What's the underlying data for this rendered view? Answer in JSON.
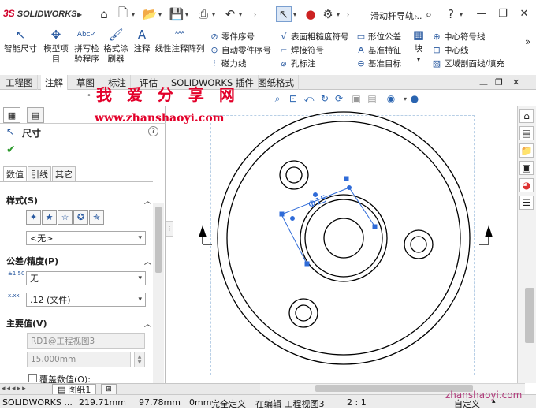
{
  "app": {
    "brand": "SOLIDWORKS",
    "brand_prefix": "3S",
    "doc_title": "滑动杆导轨...",
    "toolbar_icons": [
      "home-icon",
      "new-file-icon",
      "open-folder-icon",
      "save-icon",
      "print-icon",
      "undo-icon",
      "select-arrow-icon",
      "traffic-light-icon",
      "options-gear-icon"
    ]
  },
  "ribbon": {
    "smart_dim": "智能尺寸",
    "model_items_1": "模型项",
    "model_items_2": "目",
    "spell_1": "拼写检",
    "spell_2": "验程序",
    "format_1": "格式涂",
    "format_2": "刷器",
    "note": "注释",
    "linear_note": "线性注释阵列",
    "balloon": "零件序号",
    "auto_balloon": "自动零件序号",
    "magnetic_line": "磁力线",
    "surface_finish": "表面粗糙度符号",
    "weld_symbol": "焊接符号",
    "hole_callout": "孔标注",
    "geom_tol": "形位公差",
    "datum_feature": "基准特征",
    "datum_target": "基准目标",
    "block": "块",
    "center_mark": "中心符号线",
    "centerline": "中心线",
    "area_hatch": "区域剖面线/填充"
  },
  "tabs": [
    "工程图",
    "注解",
    "草图",
    "标注",
    "评估",
    "SOLIDWORKS 插件",
    "图纸格式"
  ],
  "active_tab": "注解",
  "panel": {
    "title": "尺寸",
    "ok_icon": "check-icon",
    "help_icon": "help-icon",
    "subtabs": [
      "数值",
      "引线",
      "其它"
    ],
    "style_section": "样式(S)",
    "style_value": "<无>",
    "tolerance_section": "公差/精度(P)",
    "tolerance_type": "无",
    "precision": ".12 (文件)",
    "primary_section": "主要值(V)",
    "primary_name": "RD1@工程视图3",
    "primary_value": "15.000mm",
    "override_label": "覆盖数值(O):"
  },
  "drawing": {
    "dim_text": "Φ15"
  },
  "sheet_tab": "图纸1",
  "status": {
    "product": "SOLIDWORKS ...",
    "x": "219.71mm",
    "y": "97.78mm",
    "z": "0mm",
    "state": "完全定义",
    "editing": "在编辑 工程视图3",
    "scale": "2 : 1",
    "units": "自定义"
  },
  "watermark": {
    "cn": "我 爱 分 享 网",
    "url": "www.zhanshaoyi.com",
    "url2": "zhanshaoyi.com"
  }
}
